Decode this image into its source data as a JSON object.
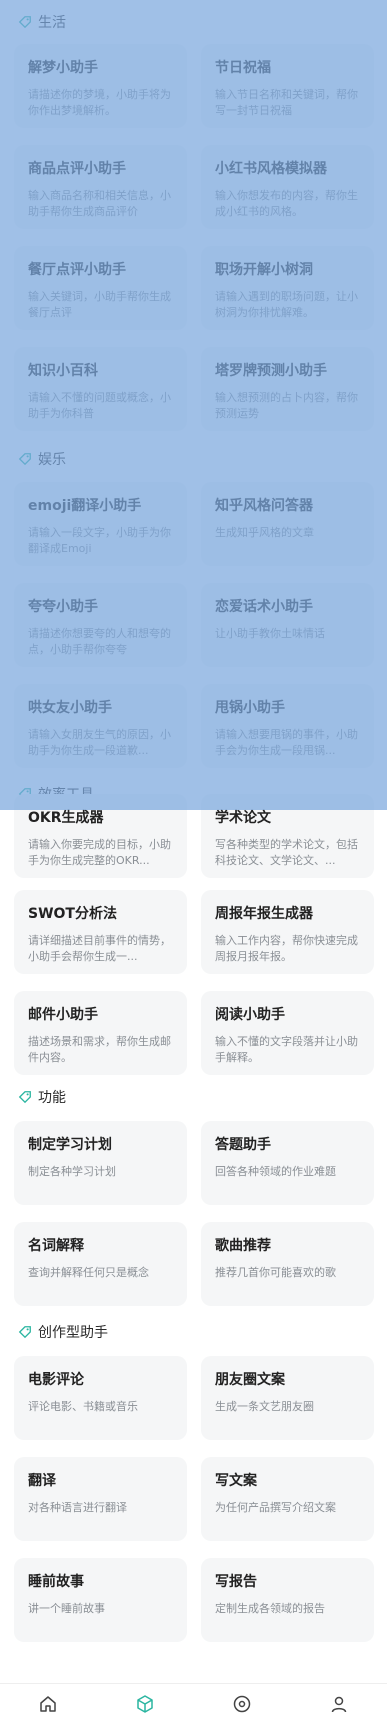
{
  "sections": [
    {
      "title": "生活"
    },
    {
      "title": "娱乐"
    },
    {
      "title": "效率工具"
    },
    {
      "title": "功能"
    },
    {
      "title": "创作型助手"
    }
  ],
  "cards": [
    {
      "title": "解梦小助手",
      "desc": "请描述你的梦境，小助手将为你作出梦境解析。"
    },
    {
      "title": "节日祝福",
      "desc": "输入节日名称和关键词，帮你写一封节日祝福"
    },
    {
      "title": "商品点评小助手",
      "desc": "输入商品名称和相关信息，小助手帮你生成商品评价"
    },
    {
      "title": "小红书风格模拟器",
      "desc": "输入你想发布的内容，帮你生成小红书的风格。"
    },
    {
      "title": "餐厅点评小助手",
      "desc": "输入关键词，小助手帮你生成餐厅点评"
    },
    {
      "title": "职场开解小树洞",
      "desc": "请输入遇到的职场问题，让小树洞为你排忧解难。"
    },
    {
      "title": "知识小百科",
      "desc": "请输入不懂的问题或概念，小助手为你科普"
    },
    {
      "title": "塔罗牌预测小助手",
      "desc": "输入想预测的占卜内容，帮你预测运势"
    },
    {
      "title": "emoji翻译小助手",
      "desc": "请输入一段文字，小助手为你翻译成Emoji"
    },
    {
      "title": "知乎风格问答器",
      "desc": "生成知乎风格的文章"
    },
    {
      "title": "夸夸小助手",
      "desc": "请描述你想要夸的人和想夸的点，小助手帮你夸夸"
    },
    {
      "title": "恋爱话术小助手",
      "desc": "让小助手教你土味情话"
    },
    {
      "title": "哄女友小助手",
      "desc": "请输入女朋友生气的原因，小助手为你生成一段道歉..."
    },
    {
      "title": "甩锅小助手",
      "desc": "请输入想要甩锅的事件，小助手会为你生成一段甩锅..."
    },
    {
      "title": "OKR生成器",
      "desc": "请输入你要完成的目标，小助手为你生成完整的OKR..."
    },
    {
      "title": "学术论文",
      "desc": "写各种类型的学术论文，包括科技论文、文学论文、..."
    },
    {
      "title": "SWOT分析法",
      "desc": "请详细描述目前事件的情势，小助手会帮你生成一..."
    },
    {
      "title": "周报年报生成器",
      "desc": "输入工作内容，帮你快速完成周报月报年报。"
    },
    {
      "title": "邮件小助手",
      "desc": "描述场景和需求，帮你生成邮件内容。"
    },
    {
      "title": "阅读小助手",
      "desc": "输入不懂的文字段落并让小助手解释。"
    },
    {
      "title": "制定学习计划",
      "desc": "制定各种学习计划"
    },
    {
      "title": "答题助手",
      "desc": "回答各种领域的作业难题"
    },
    {
      "title": "名词解释",
      "desc": "查询并解释任何只是概念"
    },
    {
      "title": "歌曲推荐",
      "desc": "推荐几首你可能喜欢的歌"
    },
    {
      "title": "电影评论",
      "desc": "评论电影、书籍或音乐"
    },
    {
      "title": "朋友圈文案",
      "desc": "生成一条文艺朋友圈"
    },
    {
      "title": "翻译",
      "desc": "对各种语言进行翻译"
    },
    {
      "title": "写文案",
      "desc": "为任何产品撰写介绍文案"
    },
    {
      "title": "睡前故事",
      "desc": "讲一个睡前故事"
    },
    {
      "title": "写报告",
      "desc": "定制生成各领域的报告"
    }
  ],
  "tabbar": {
    "items": [
      {
        "icon": "home-icon"
      },
      {
        "icon": "cube-icon",
        "active": true
      },
      {
        "icon": "compass-icon"
      },
      {
        "icon": "user-icon"
      }
    ],
    "active_color": "#2ab5a0"
  },
  "overlay_color": "#7ca8de"
}
